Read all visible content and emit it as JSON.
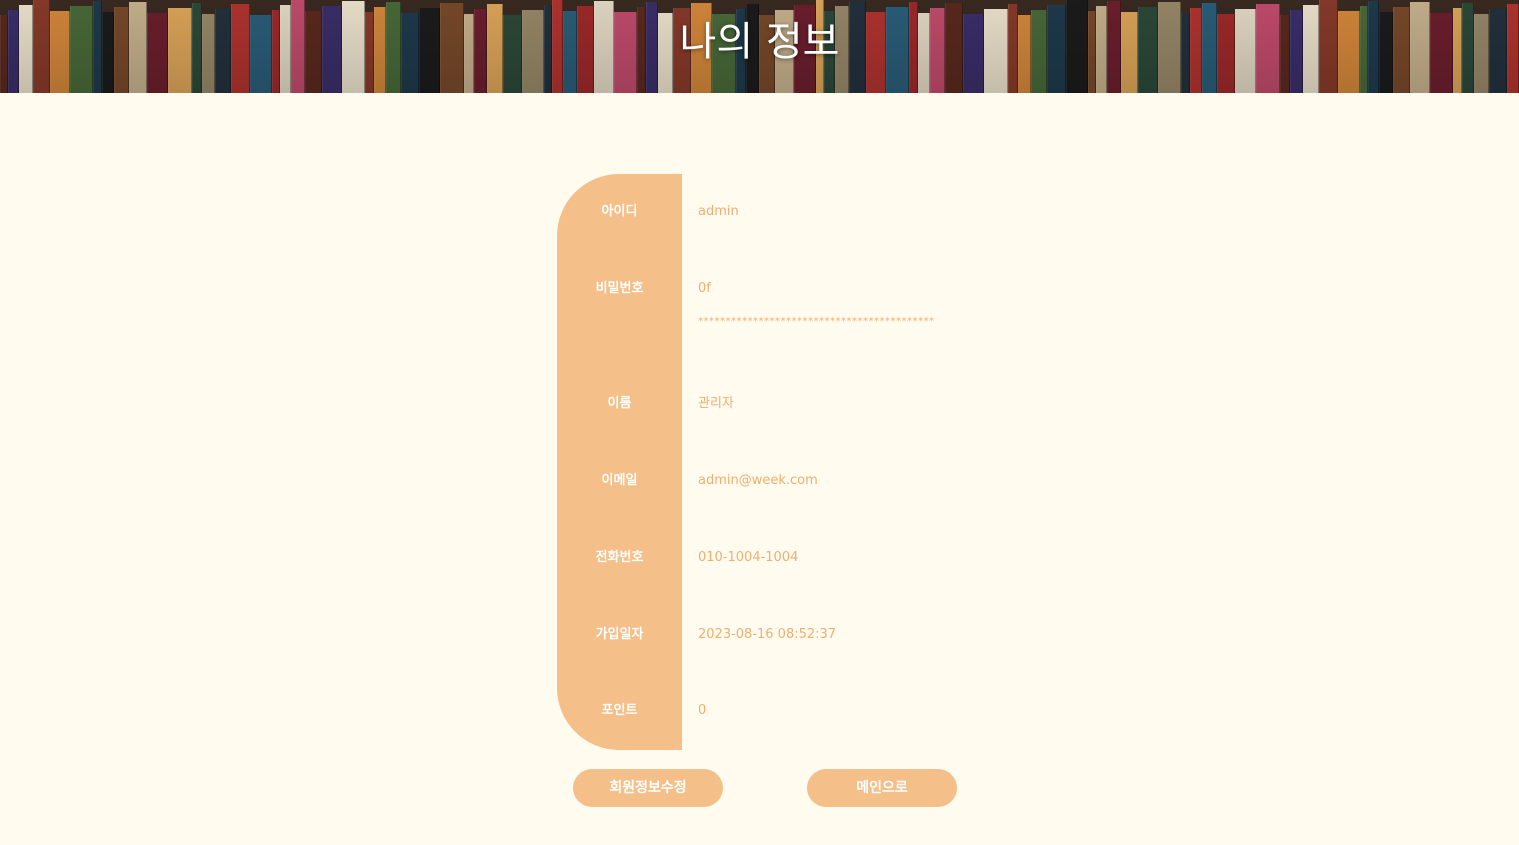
{
  "header": {
    "title": "나의 정보"
  },
  "profile": {
    "fields": [
      {
        "label": "아이디",
        "value": "admin"
      },
      {
        "label": "비밀번호",
        "value": "0f",
        "mask": "*******************************************"
      },
      {
        "label": "이름",
        "value": "관리자"
      },
      {
        "label": "이메일",
        "value": "admin@week.com"
      },
      {
        "label": "전화번호",
        "value": "010-1004-1004"
      },
      {
        "label": "가입일자",
        "value": "2023-08-16 08:52:37"
      },
      {
        "label": "포인트",
        "value": "0"
      }
    ]
  },
  "actions": {
    "edit_label": "회원정보수정",
    "main_label": "메인으로"
  },
  "colors": {
    "background": "#fffcef",
    "accent": "#f5bf89",
    "value_text": "#f0ae70"
  }
}
